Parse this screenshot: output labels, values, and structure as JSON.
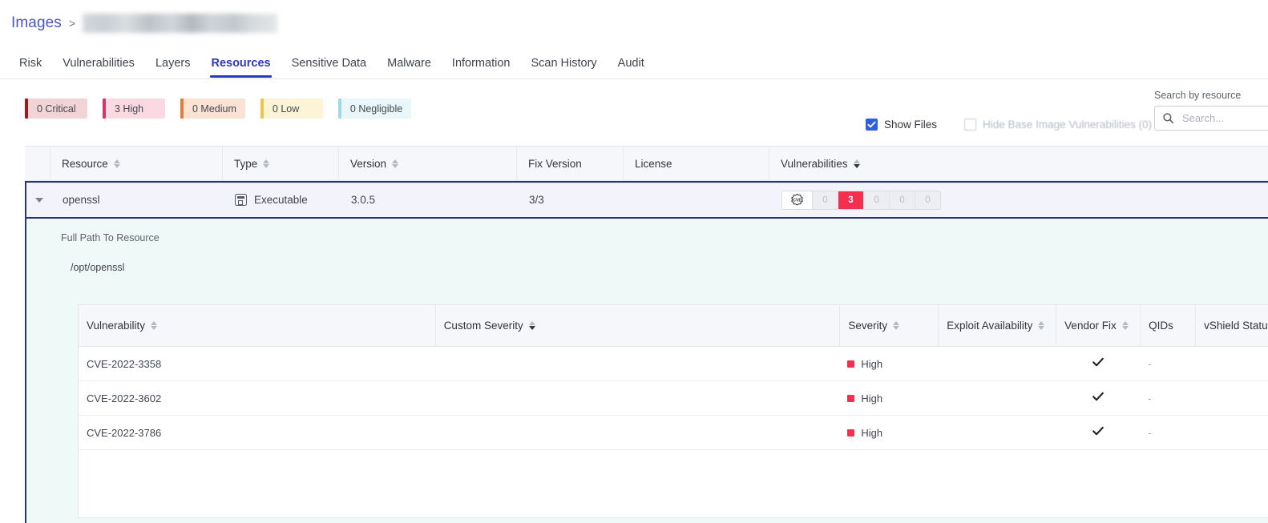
{
  "breadcrumb": {
    "root_label": "Images",
    "separator": ">",
    "current_redacted": true
  },
  "tabs": [
    {
      "label": "Risk",
      "active": false
    },
    {
      "label": "Vulnerabilities",
      "active": false
    },
    {
      "label": "Layers",
      "active": false
    },
    {
      "label": "Resources",
      "active": true
    },
    {
      "label": "Sensitive Data",
      "active": false
    },
    {
      "label": "Malware",
      "active": false
    },
    {
      "label": "Information",
      "active": false
    },
    {
      "label": "Scan History",
      "active": false
    },
    {
      "label": "Audit",
      "active": false
    }
  ],
  "severity_chips": [
    {
      "label": "0 Critical",
      "bar": "#a4161a",
      "bg": "#f2d4d7"
    },
    {
      "label": "3 High",
      "bar": "#d6336c",
      "bg": "#fbd9e2"
    },
    {
      "label": "0 Medium",
      "bar": "#e8783c",
      "bg": "#fbe2d3"
    },
    {
      "label": "0 Low",
      "bar": "#f2c14e",
      "bg": "#fdf3d6"
    },
    {
      "label": "0 Negligible",
      "bar": "#9fd8e8",
      "bg": "#e9f6fa"
    }
  ],
  "toolbar": {
    "show_files_label": "Show Files",
    "show_files_checked": true,
    "hide_base_label": "Hide Base Image Vulnerabilities (0)",
    "hide_base_checked": false,
    "hide_base_disabled": true
  },
  "search": {
    "label": "Search by resource",
    "placeholder": "Search...",
    "value": "",
    "icon": "search-icon"
  },
  "resource_table": {
    "columns": [
      {
        "key": "expand",
        "label": "",
        "sortable": false
      },
      {
        "key": "resource",
        "label": "Resource",
        "sortable": true,
        "sort_active": false
      },
      {
        "key": "type",
        "label": "Type",
        "sortable": true,
        "sort_active": false
      },
      {
        "key": "version",
        "label": "Version",
        "sortable": true,
        "sort_active": false
      },
      {
        "key": "fix",
        "label": "Fix Version",
        "sortable": false
      },
      {
        "key": "license",
        "label": "License",
        "sortable": false
      },
      {
        "key": "vulns",
        "label": "Vulnerabilities",
        "sortable": true,
        "sort_active": true
      }
    ],
    "row": {
      "expanded": true,
      "resource": "openssl",
      "type": "Executable",
      "type_icon": "executable-icon",
      "version": "3.0.5",
      "fix_version": "3/3",
      "license": "",
      "vuln_icon": "cve-badge-icon",
      "vuln_counts": [
        {
          "value": "0",
          "active": false
        },
        {
          "value": "3",
          "active": true
        },
        {
          "value": "0",
          "active": false
        },
        {
          "value": "0",
          "active": false
        },
        {
          "value": "0",
          "active": false
        }
      ]
    }
  },
  "expanded_detail": {
    "path_label": "Full Path To Resource",
    "path_value": "/opt/openssl"
  },
  "vulnerability_table": {
    "columns": [
      {
        "key": "vulnerability",
        "label": "Vulnerability",
        "sortable": true,
        "sort_active": false
      },
      {
        "key": "custom_severity",
        "label": "Custom Severity",
        "sortable": true,
        "sort_active": true
      },
      {
        "key": "severity",
        "label": "Severity",
        "sortable": true,
        "sort_active": false
      },
      {
        "key": "exploit",
        "label": "Exploit Availability",
        "sortable": true,
        "sort_active": false
      },
      {
        "key": "vendor_fix",
        "label": "Vendor Fix",
        "sortable": true,
        "sort_active": false
      },
      {
        "key": "qids",
        "label": "QIDs",
        "sortable": false
      },
      {
        "key": "vshield",
        "label": "vShield Status",
        "sortable": false
      }
    ],
    "rows": [
      {
        "vulnerability": "CVE-2022-3358",
        "custom_severity": "",
        "severity": "High",
        "severity_color": "#f5304e",
        "exploit": "",
        "vendor_fix": "check-icon",
        "qids": "-",
        "vshield": ""
      },
      {
        "vulnerability": "CVE-2022-3602",
        "custom_severity": "",
        "severity": "High",
        "severity_color": "#f5304e",
        "exploit": "",
        "vendor_fix": "check-icon",
        "qids": "-",
        "vshield": ""
      },
      {
        "vulnerability": "CVE-2022-3786",
        "custom_severity": "",
        "severity": "High",
        "severity_color": "#f5304e",
        "exploit": "",
        "vendor_fix": "check-icon",
        "qids": "-",
        "vshield": ""
      }
    ]
  }
}
